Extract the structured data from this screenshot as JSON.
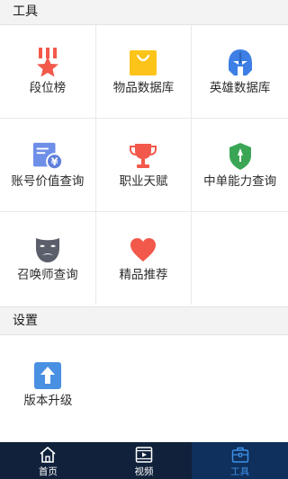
{
  "tools_section": {
    "title": "工具",
    "items": [
      {
        "label": "段位榜",
        "icon": "rank-medal-icon"
      },
      {
        "label": "物品数据库",
        "icon": "shopping-bag-icon"
      },
      {
        "label": "英雄数据库",
        "icon": "helmet-icon"
      },
      {
        "label": "账号价值查询",
        "icon": "account-value-icon"
      },
      {
        "label": "职业天赋",
        "icon": "trophy-icon"
      },
      {
        "label": "中单能力查询",
        "icon": "shield-icon"
      },
      {
        "label": "召唤师查询",
        "icon": "mask-icon"
      },
      {
        "label": "精品推荐",
        "icon": "heart-icon"
      }
    ]
  },
  "settings_section": {
    "title": "设置",
    "items": [
      {
        "label": "版本升级",
        "icon": "upgrade-arrow-icon"
      }
    ]
  },
  "tabbar": {
    "active_index": 2,
    "tabs": [
      {
        "label": "首页",
        "icon": "home-icon"
      },
      {
        "label": "视频",
        "icon": "video-icon"
      },
      {
        "label": "工具",
        "icon": "toolbox-icon"
      }
    ]
  },
  "colors": {
    "tabbar_bg": "#11213b",
    "tab_active_bg": "#0f2f5c",
    "tab_active_text": "#3f8fe5",
    "rank_icon": "#f2594b",
    "bag_icon": "#fcc419",
    "helmet_icon": "#3d7fe4",
    "account_icon": "#6e8fe8",
    "trophy_icon": "#f2594b",
    "shield_icon": "#3aa655",
    "mask_icon": "#5a5f6b",
    "heart_icon": "#f2594b",
    "upgrade_icon": "#4a90e2"
  }
}
